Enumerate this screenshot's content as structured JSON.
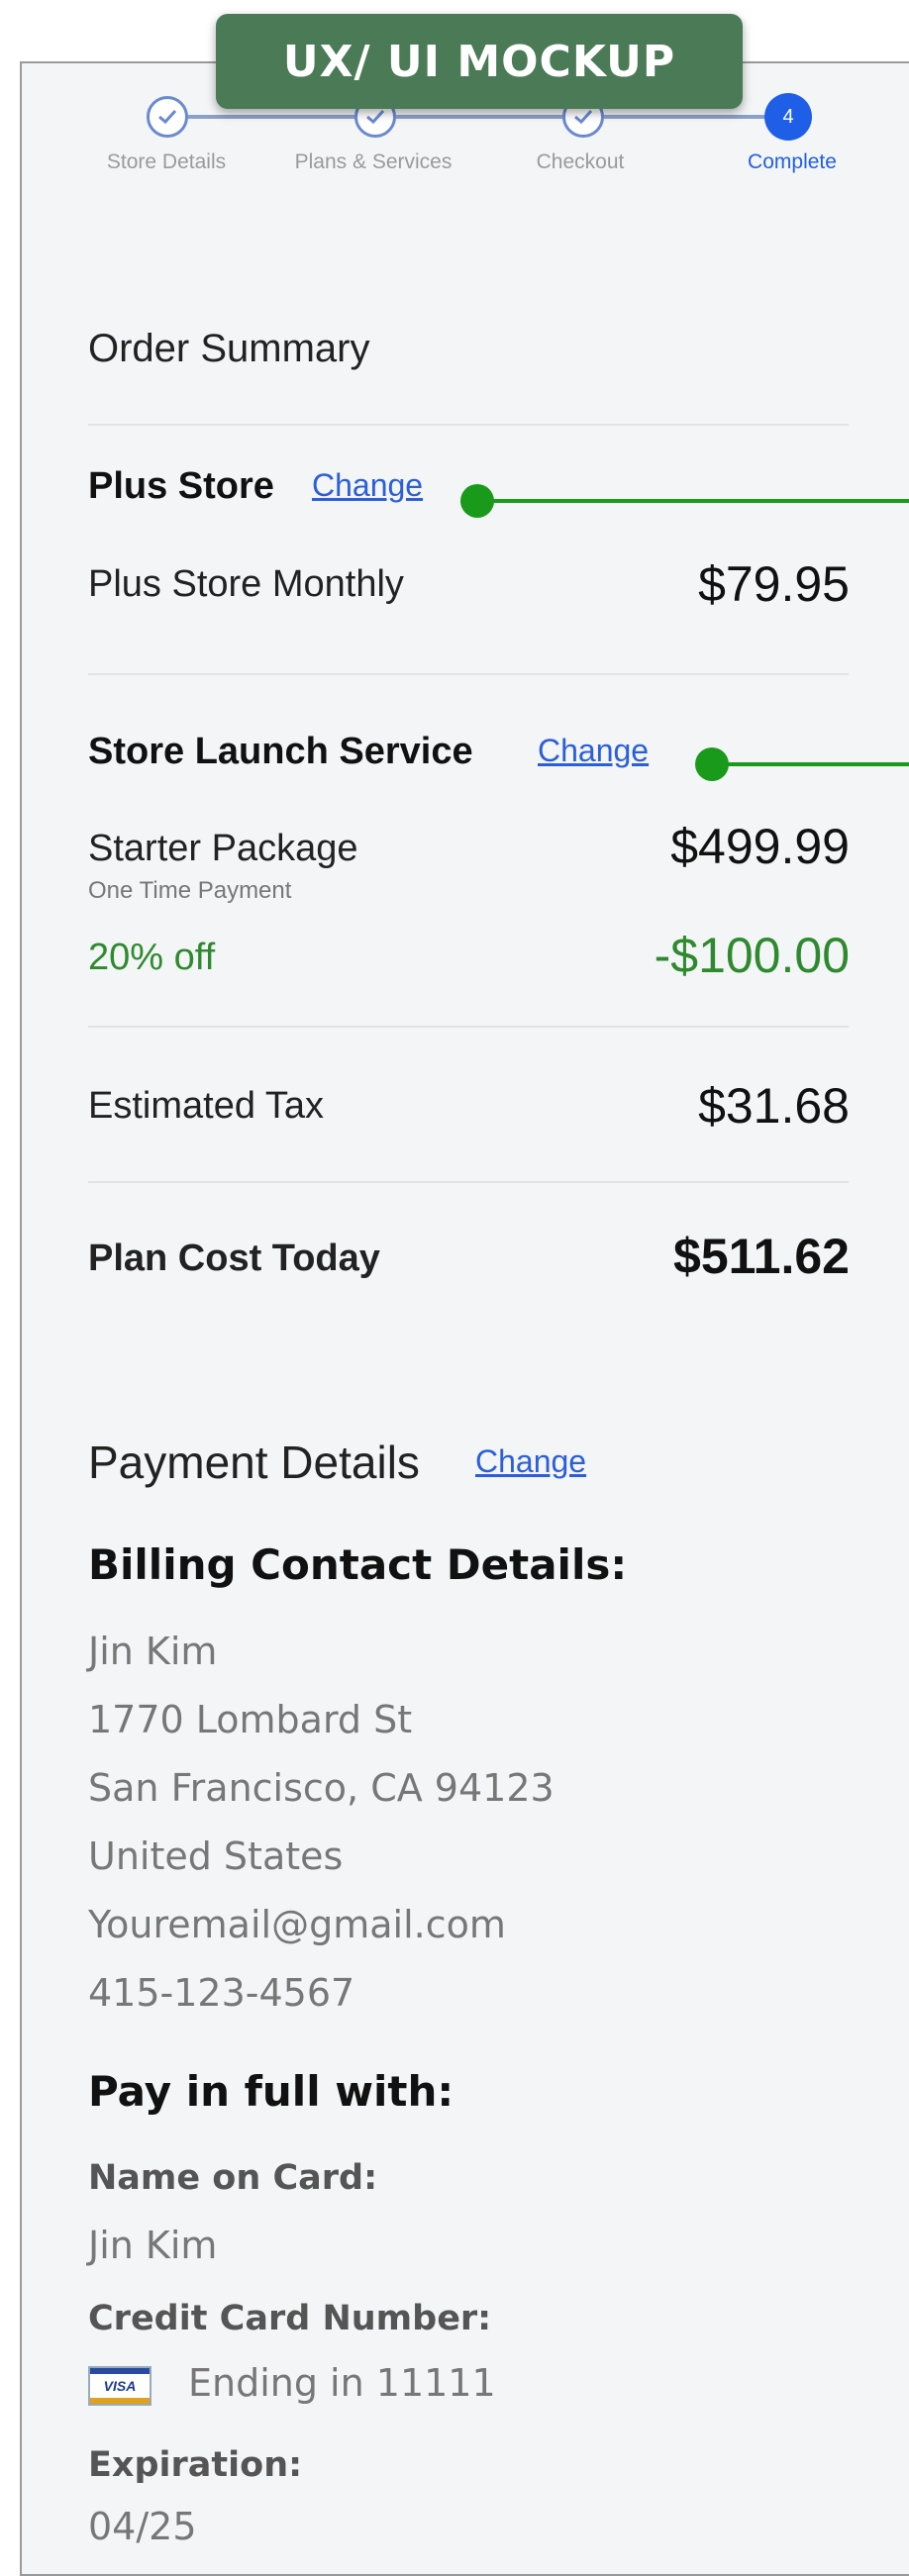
{
  "badge": "UX/ UI MOCKUP",
  "steps": [
    {
      "label": "Store Details",
      "state": "done"
    },
    {
      "label": "Plans & Services",
      "state": "done"
    },
    {
      "label": "Checkout",
      "state": "done"
    },
    {
      "label": "Complete",
      "state": "active",
      "number": "4"
    }
  ],
  "order_summary": {
    "title": "Order Summary",
    "plan": {
      "title": "Plus Store",
      "change": "Change",
      "item_label": "Plus Store Monthly",
      "item_price": "$79.95"
    },
    "service": {
      "title": "Store Launch Service",
      "change": "Change",
      "item_label": "Starter Package",
      "item_sub": "One Time Payment",
      "item_price": "$499.99",
      "discount_label": "20% off",
      "discount_value": "-$100.00"
    },
    "tax_label": "Estimated Tax",
    "tax_value": "$31.68",
    "total_label": "Plan Cost Today",
    "total_value": "$511.62"
  },
  "payment": {
    "title": "Payment Details",
    "change": "Change",
    "billing_heading": "Billing Contact Details:",
    "billing_lines": [
      "Jin Kim",
      "1770 Lombard St",
      "San Francisco, CA 94123",
      "United States",
      "Youremail@gmail.com",
      "415-123-4567"
    ],
    "pay_heading": "Pay in full with:",
    "name_label": "Name on Card:",
    "name_value": "Jin Kim",
    "card_label": "Credit Card Number:",
    "card_brand": "VISA",
    "card_value": "Ending in 11111",
    "exp_label": "Expiration:",
    "exp_value": "04/25"
  },
  "colors": {
    "accent": "#1f5fe8",
    "discount": "#2f8a2f",
    "annotation": "#1a9a1a",
    "badge": "#4b7a56"
  }
}
